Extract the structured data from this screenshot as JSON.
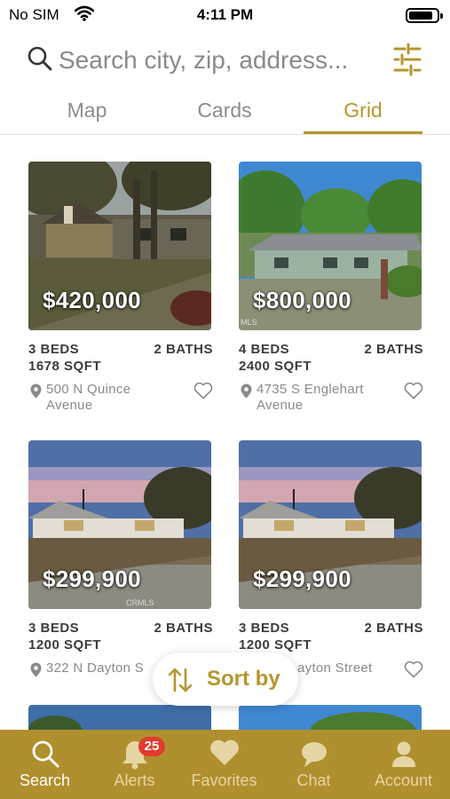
{
  "status_bar": {
    "carrier": "No SIM",
    "time": "4:11 PM"
  },
  "search": {
    "placeholder": "Search city, zip, address..."
  },
  "tabs": [
    {
      "label": "Map",
      "active": false
    },
    {
      "label": "Cards",
      "active": false
    },
    {
      "label": "Grid",
      "active": true
    }
  ],
  "listings": [
    {
      "price": "$420,000",
      "beds": "3 BEDS",
      "baths": "2 BATHS",
      "sqft": "1678 SQFT",
      "address": "500 N Quince Avenue",
      "watermark": ""
    },
    {
      "price": "$800,000",
      "beds": "4 BEDS",
      "baths": "2 BATHS",
      "sqft": "2400 SQFT",
      "address": "4735 S Englehart Avenue",
      "watermark": "MLS"
    },
    {
      "price": "$299,900",
      "beds": "3 BEDS",
      "baths": "2 BATHS",
      "sqft": "1200 SQFT",
      "address": "322 N Dayton S",
      "watermark": "CRMLS"
    },
    {
      "price": "$299,900",
      "beds": "3 BEDS",
      "baths": "2 BATHS",
      "sqft": "1200 SQFT",
      "address": "ayton Street",
      "watermark": ""
    }
  ],
  "sort_button": {
    "label": "Sort by"
  },
  "bottom_nav": [
    {
      "label": "Search",
      "icon": "search-icon",
      "active": true
    },
    {
      "label": "Alerts",
      "icon": "bell-icon",
      "badge": "25"
    },
    {
      "label": "Favorites",
      "icon": "heart-icon"
    },
    {
      "label": "Chat",
      "icon": "chat-bubble-icon"
    },
    {
      "label": "Account",
      "icon": "person-icon"
    }
  ],
  "colors": {
    "accent": "#b5962f",
    "nav_bg": "#b08f2e",
    "badge": "#e23b2e"
  }
}
